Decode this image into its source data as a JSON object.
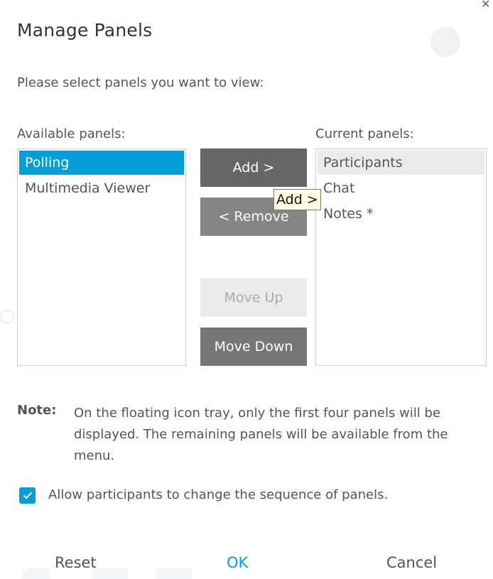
{
  "dialog": {
    "title": "Manage Panels",
    "close_icon": "close-icon",
    "prompt": "Please select panels you want to view:"
  },
  "available": {
    "label": "Available panels:",
    "items": [
      "Polling",
      "Multimedia Viewer"
    ],
    "selected_index": 0
  },
  "current": {
    "label": "Current panels:",
    "items": [
      "Participants",
      "Chat",
      "Notes *"
    ],
    "focused_index": 0
  },
  "buttons": {
    "add": "Add >",
    "remove": "< Remove",
    "move_up": "Move Up",
    "move_down": "Move Down"
  },
  "tooltip": "Add >",
  "note": {
    "label": "Note:",
    "text": "On the floating icon tray, only the first four panels will be displayed. The remaining panels will be available from the menu."
  },
  "checkbox": {
    "checked": true,
    "label": "Allow participants to change the sequence of panels."
  },
  "footer": {
    "reset": "Reset",
    "ok": "OK",
    "cancel": "Cancel"
  },
  "colors": {
    "accent": "#049fd9",
    "button_dark": "#666666",
    "button_mid": "#858585",
    "button_disabled": "#ebebeb"
  }
}
